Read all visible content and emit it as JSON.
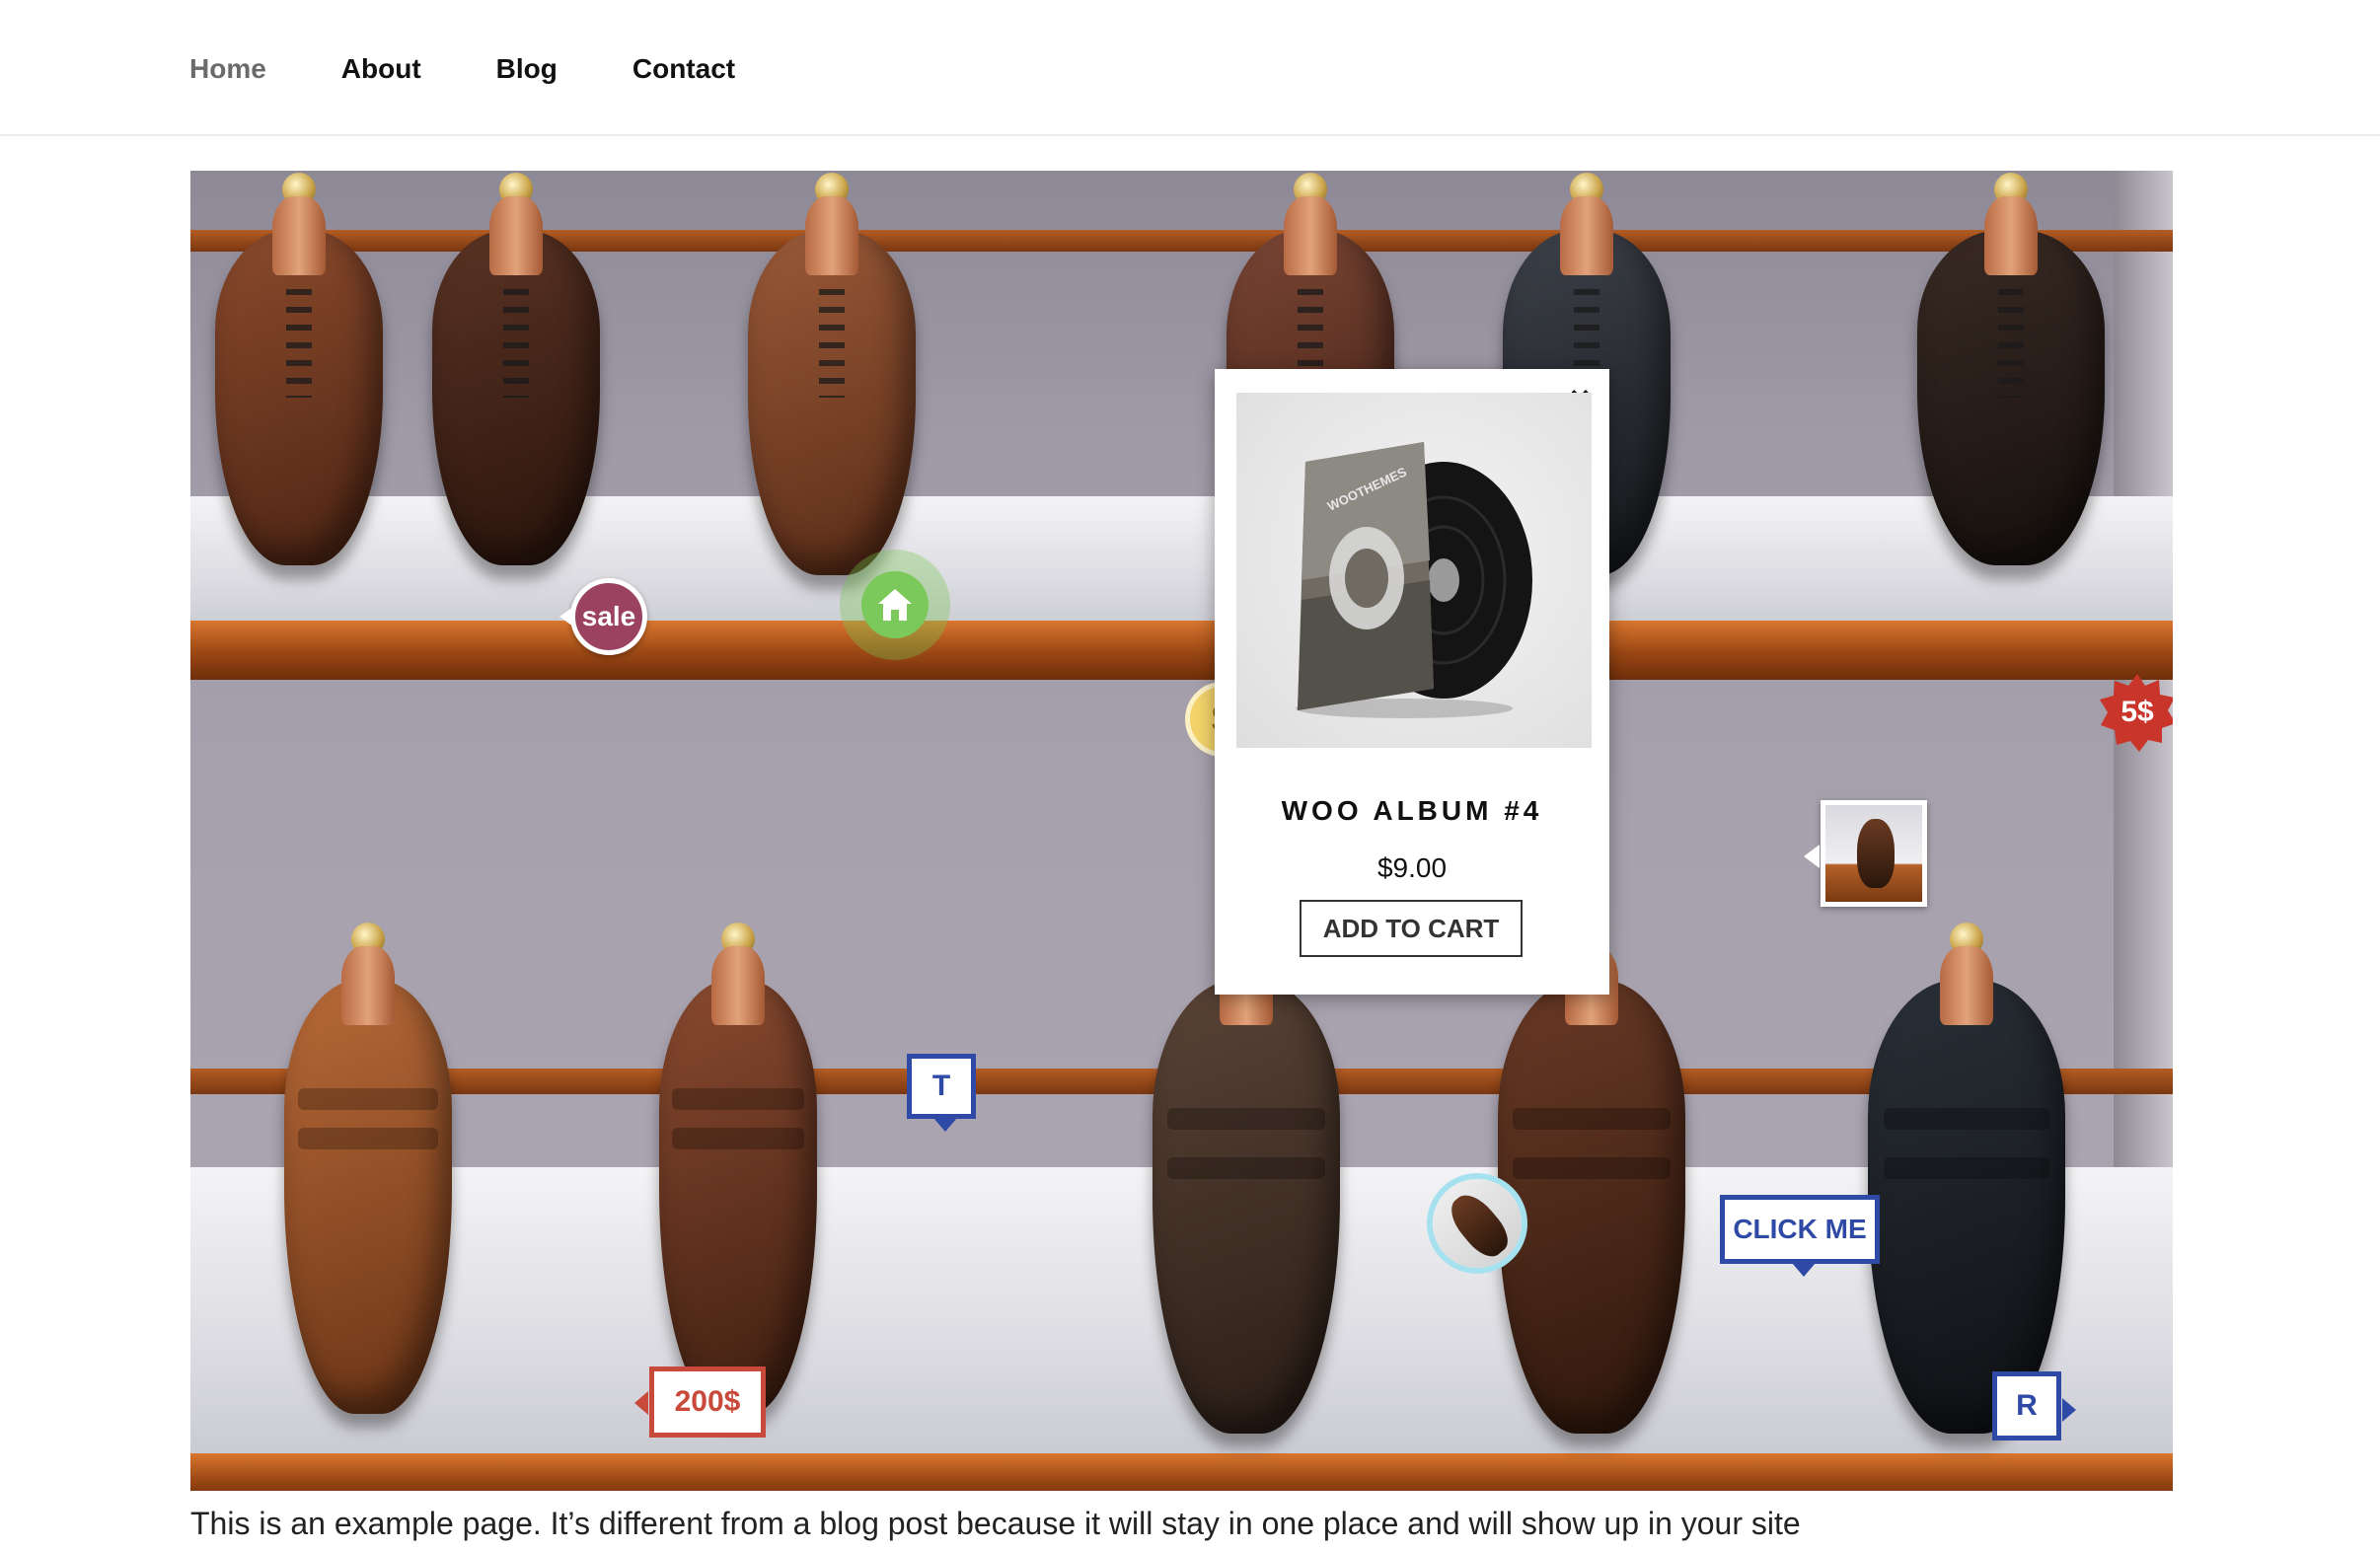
{
  "nav": {
    "items": [
      {
        "label": "Home",
        "current": true
      },
      {
        "label": "About",
        "current": false
      },
      {
        "label": "Blog",
        "current": false
      },
      {
        "label": "Contact",
        "current": false
      }
    ]
  },
  "hotspots": {
    "sale_label": "sale",
    "dollar_label": "$",
    "five_label": "5$",
    "t_label": "T",
    "price_200_label": "200$",
    "click_label": "CLICK ME",
    "r_label": "R"
  },
  "popup": {
    "title": "WOO ALBUM #4",
    "price": "$9.00",
    "button": "ADD TO CART",
    "close": "×",
    "album_text": "WOOTHEMES"
  },
  "colors": {
    "sale": "#9b4261",
    "home": "#7ac95a",
    "dollar": "#f3d36a",
    "five": "#c9352b",
    "blue_tag": "#2f4aa6",
    "red_tag": "#c94a3a",
    "shoe_ring": "#a6e1ef"
  },
  "content": {
    "paragraph": "This is an example page. It’s different from a blog post because it will stay in one place and will show up in your site"
  }
}
